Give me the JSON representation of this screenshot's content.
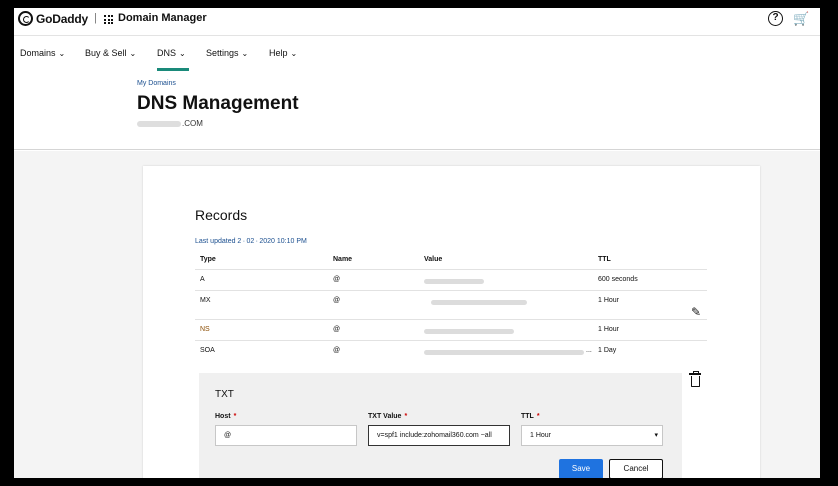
{
  "app": {
    "brand": "GoDaddy",
    "separator": "|",
    "title": "Domain Manager"
  },
  "topbar": {
    "help_glyph": "?",
    "cart_glyph": "🛒"
  },
  "nav": {
    "items": [
      {
        "label": "Domains"
      },
      {
        "label": "Buy & Sell"
      },
      {
        "label": "DNS"
      },
      {
        "label": "Settings"
      },
      {
        "label": "Help"
      }
    ],
    "active": "DNS",
    "chevron": "⌄"
  },
  "header": {
    "breadcrumb": "My Domains",
    "title": "DNS Management",
    "domain_suffix": ".COM"
  },
  "records": {
    "title": "Records",
    "last_updated": "Last updated 2 · 02 · 2020 10:10 PM",
    "columns": {
      "type": "Type",
      "name": "Name",
      "value": "Value",
      "ttl": "TTL"
    },
    "rows": [
      {
        "type": "A",
        "name": "@",
        "ttl": "600 seconds"
      },
      {
        "type": "MX",
        "name": "@",
        "ttl": "1 Hour"
      },
      {
        "type": "NS",
        "name": "@",
        "ttl": "1 Hour"
      },
      {
        "type": "SOA",
        "name": "@",
        "value_suffix": "...",
        "ttl": "1 Day"
      }
    ]
  },
  "editor": {
    "title": "TXT",
    "host_label": "Host",
    "host_value": "@",
    "txt_value_label": "TXT Value",
    "txt_value": "v=spf1 include:zohomail360.com ~all",
    "ttl_label": "TTL",
    "ttl_value": "1 Hour",
    "required_mark": "*",
    "save_label": "Save",
    "cancel_label": "Cancel"
  },
  "colors": {
    "accent": "#1a8a7a",
    "link": "#1b4f8f",
    "primary_button": "#1f73e0",
    "required": "#cc0000"
  }
}
